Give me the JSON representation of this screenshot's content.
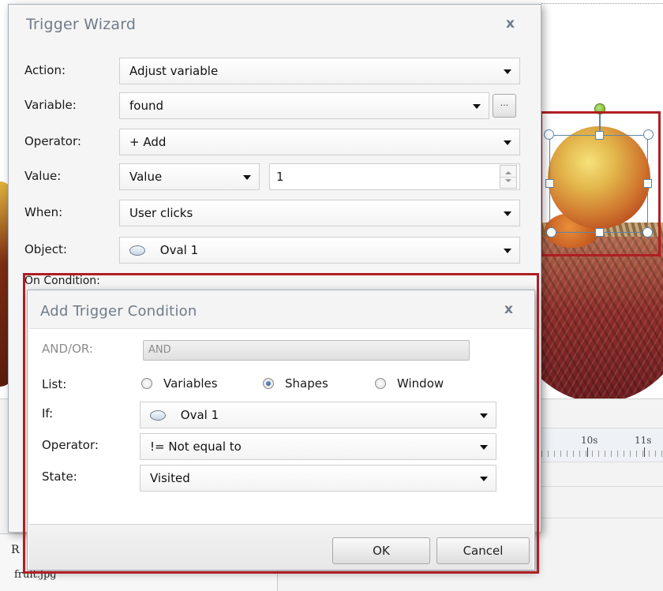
{
  "wizard": {
    "title": "Trigger Wizard",
    "close_label": "x",
    "action_label": "Action:",
    "action_value": "Adjust variable",
    "variable_label": "Variable:",
    "variable_value": "found",
    "browse_label": "...",
    "operator_label": "Operator:",
    "operator_value": "+ Add",
    "value_label": "Value:",
    "value_type": "Value",
    "value_number": "1",
    "when_label": "When:",
    "when_value": "User clicks",
    "object_label": "Object:",
    "object_value": "Oval 1",
    "on_condition_label": "On Condition:"
  },
  "condition": {
    "title": "Add Trigger Condition",
    "close_label": "x",
    "andor_label": "AND/OR:",
    "andor_value": "AND",
    "list_label": "List:",
    "list_options": [
      "Variables",
      "Shapes",
      "Window"
    ],
    "list_selected": "Shapes",
    "if_label": "If:",
    "if_value": "Oval 1",
    "operator_label": "Operator:",
    "operator_value": "!= Not equal to",
    "state_label": "State:",
    "state_value": "Visited",
    "ok_label": "OK",
    "cancel_label": "Cancel"
  },
  "timeline": {
    "ticks": [
      "10s",
      "11s"
    ]
  },
  "bottom_panel": {
    "r_label": "R",
    "file_name": "fruit.jpg"
  },
  "colors": {
    "highlight_frame": "#b01e22",
    "selection": "#5b86a8",
    "title_text": "#6f7b89"
  }
}
